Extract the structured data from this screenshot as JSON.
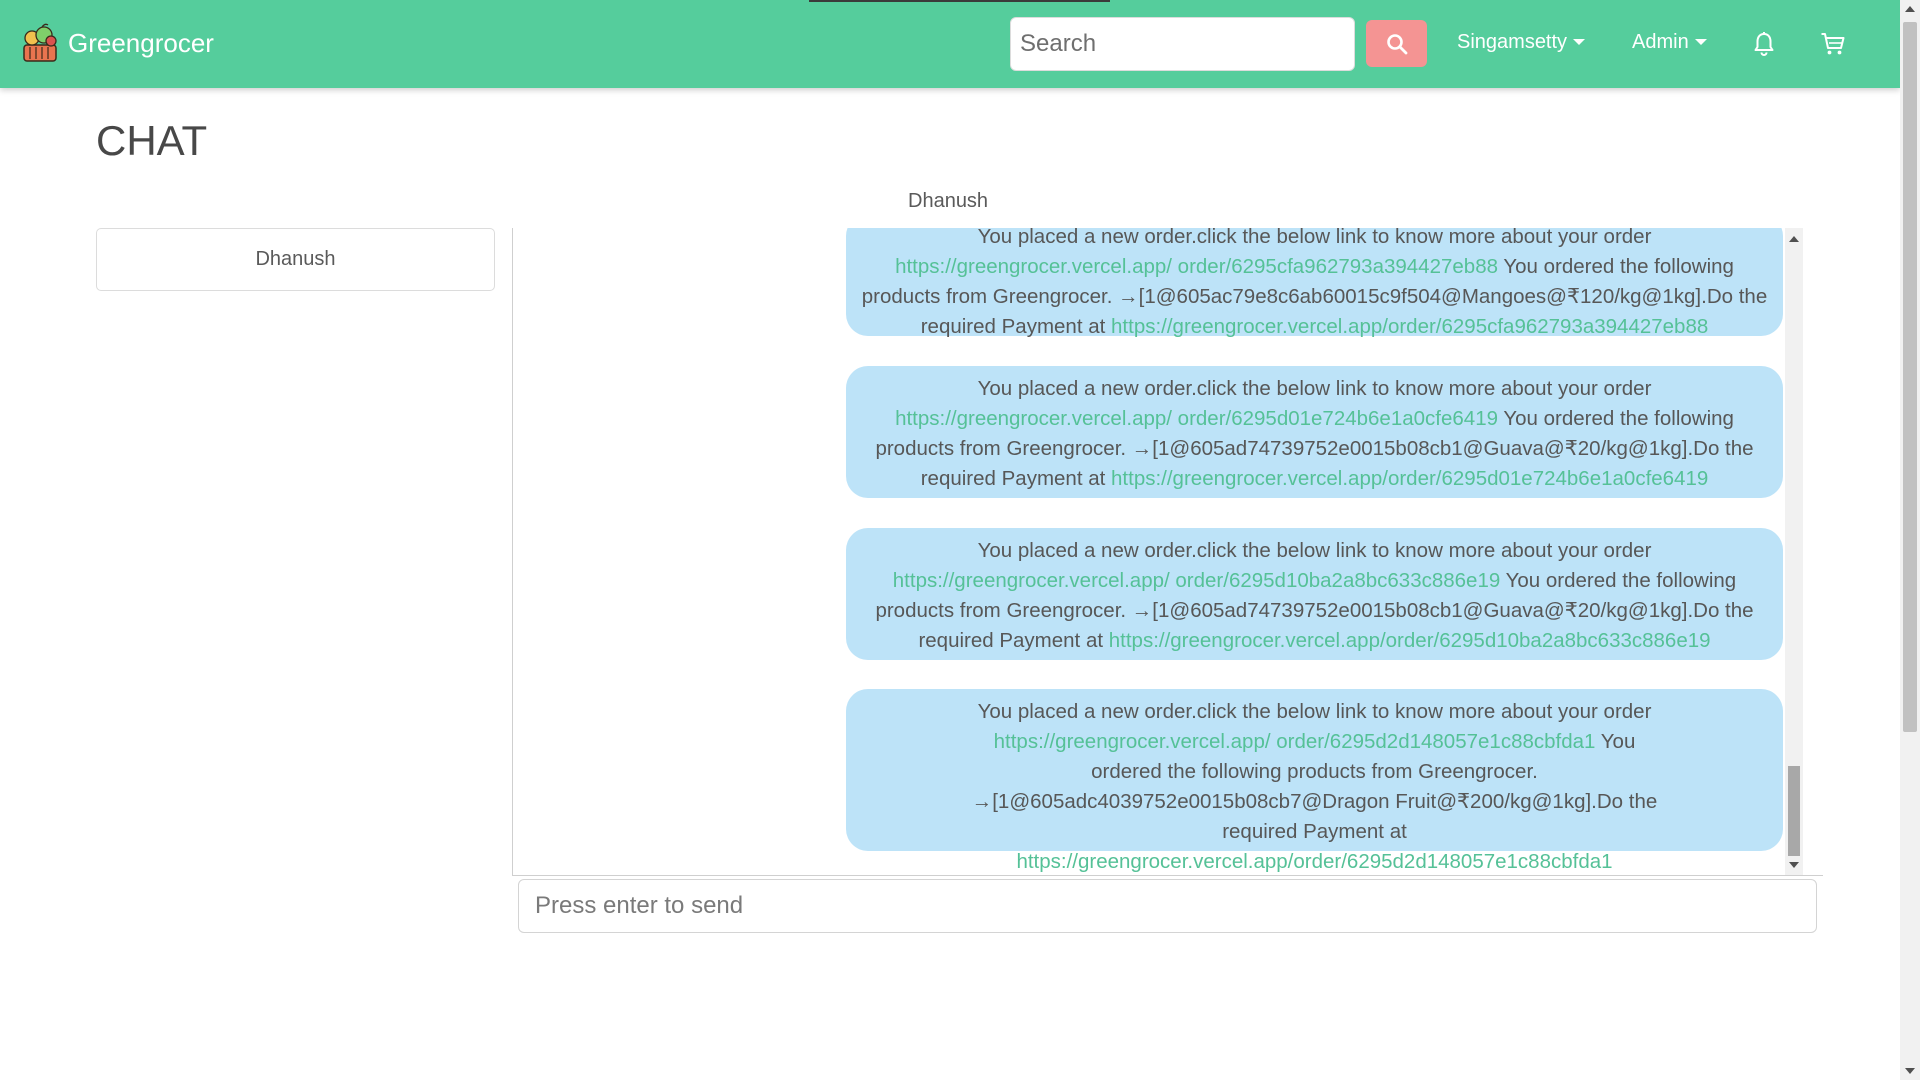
{
  "app": {
    "name": "Greengrocer"
  },
  "colors": {
    "navbar": "#55cd9c",
    "search_button": "#f49493",
    "bubble": "#bde3f8",
    "link": "#55c197"
  },
  "navbar": {
    "search_placeholder": "Search",
    "search_icon": "search-icon",
    "user_menu_label": "Singamsetty",
    "admin_menu_label": "Admin",
    "notification_icon": "bell-icon",
    "cart_icon": "cart-icon"
  },
  "page": {
    "title": "CHAT",
    "active_chat_name": "Dhanush"
  },
  "contacts": [
    {
      "name": "Dhanush"
    }
  ],
  "messages": [
    {
      "prefix": "You placed a new order.click the below link to know more about your order",
      "order_link": "https://greengrocer.vercel.app/ order/6295cfa962793a394427eb88",
      "middle": "You ordered the following products from Greengrocer. →[1@605ac79e8c6ab60015c9f504@Mangoes@₹120/kg@1kg].Do the required Payment at",
      "payment_link": "https://greengrocer.vercel.app/order/6295cfa962793a394427eb88"
    },
    {
      "prefix": "You placed a new order.click the below link to know more about your order",
      "order_link": "https://greengrocer.vercel.app/ order/6295d01e724b6e1a0cfe6419",
      "middle": "You ordered the following products from Greengrocer. →[1@605ad74739752e0015b08cb1@Guava@₹20/kg@1kg].Do the required Payment at",
      "payment_link": "https://greengrocer.vercel.app/order/6295d01e724b6e1a0cfe6419"
    },
    {
      "prefix": "You placed a new order.click the below link to know more about your order",
      "order_link": "https://greengrocer.vercel.app/ order/6295d10ba2a8bc633c886e19",
      "middle": "You ordered the following products from Greengrocer. →[1@605ad74739752e0015b08cb1@Guava@₹20/kg@1kg].Do the required Payment at",
      "payment_link": "https://greengrocer.vercel.app/order/6295d10ba2a8bc633c886e19"
    },
    {
      "prefix": "You placed a new order.click the below link to know more about your order",
      "order_link": "https://greengrocer.vercel.app/ order/6295d2d148057e1c88cbfda1",
      "middle": "You ordered the following products from Greengrocer. →[1@605adc4039752e0015b08cb7@Dragon Fruit@₹200/kg@1kg].Do the required Payment at",
      "payment_link": "https://greengrocer.vercel.app/order/6295d2d148057e1c88cbfda1"
    }
  ],
  "composer": {
    "placeholder": "Press enter to send"
  }
}
